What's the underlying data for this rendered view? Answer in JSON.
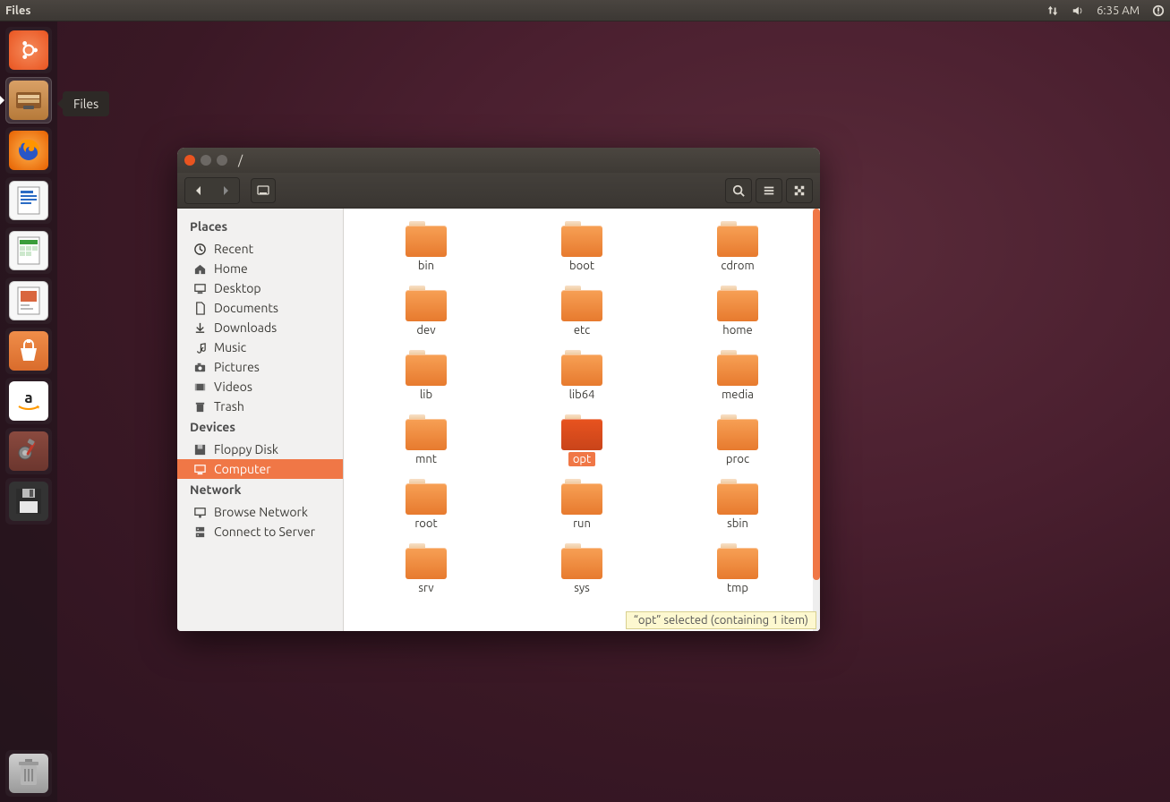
{
  "menubar": {
    "app_name": "Files",
    "time": "6:35 AM"
  },
  "launcher": {
    "tooltip": "Files",
    "items": [
      {
        "name": "ubuntu-dash"
      },
      {
        "name": "files",
        "active": true
      },
      {
        "name": "firefox"
      },
      {
        "name": "libreoffice-writer"
      },
      {
        "name": "libreoffice-calc"
      },
      {
        "name": "libreoffice-impress"
      },
      {
        "name": "software-center"
      },
      {
        "name": "amazon"
      },
      {
        "name": "system-settings"
      },
      {
        "name": "floppy"
      }
    ],
    "trash": {
      "name": "trash"
    }
  },
  "window": {
    "title": "/",
    "sidebar": {
      "sections": [
        {
          "title": "Places",
          "items": [
            {
              "label": "Recent",
              "icon": "clock"
            },
            {
              "label": "Home",
              "icon": "home"
            },
            {
              "label": "Desktop",
              "icon": "desktop"
            },
            {
              "label": "Documents",
              "icon": "document"
            },
            {
              "label": "Downloads",
              "icon": "download"
            },
            {
              "label": "Music",
              "icon": "music"
            },
            {
              "label": "Pictures",
              "icon": "camera"
            },
            {
              "label": "Videos",
              "icon": "video"
            },
            {
              "label": "Trash",
              "icon": "trash"
            }
          ]
        },
        {
          "title": "Devices",
          "items": [
            {
              "label": "Floppy Disk",
              "icon": "floppy"
            },
            {
              "label": "Computer",
              "icon": "computer",
              "selected": true
            }
          ]
        },
        {
          "title": "Network",
          "items": [
            {
              "label": "Browse Network",
              "icon": "network"
            },
            {
              "label": "Connect to Server",
              "icon": "server"
            }
          ]
        }
      ]
    },
    "folders": [
      "bin",
      "boot",
      "cdrom",
      "dev",
      "etc",
      "home",
      "lib",
      "lib64",
      "media",
      "mnt",
      "opt",
      "proc",
      "root",
      "run",
      "sbin",
      "srv",
      "sys",
      "tmp"
    ],
    "selected_folder": "opt",
    "status": "“opt” selected  (containing 1 item)"
  }
}
